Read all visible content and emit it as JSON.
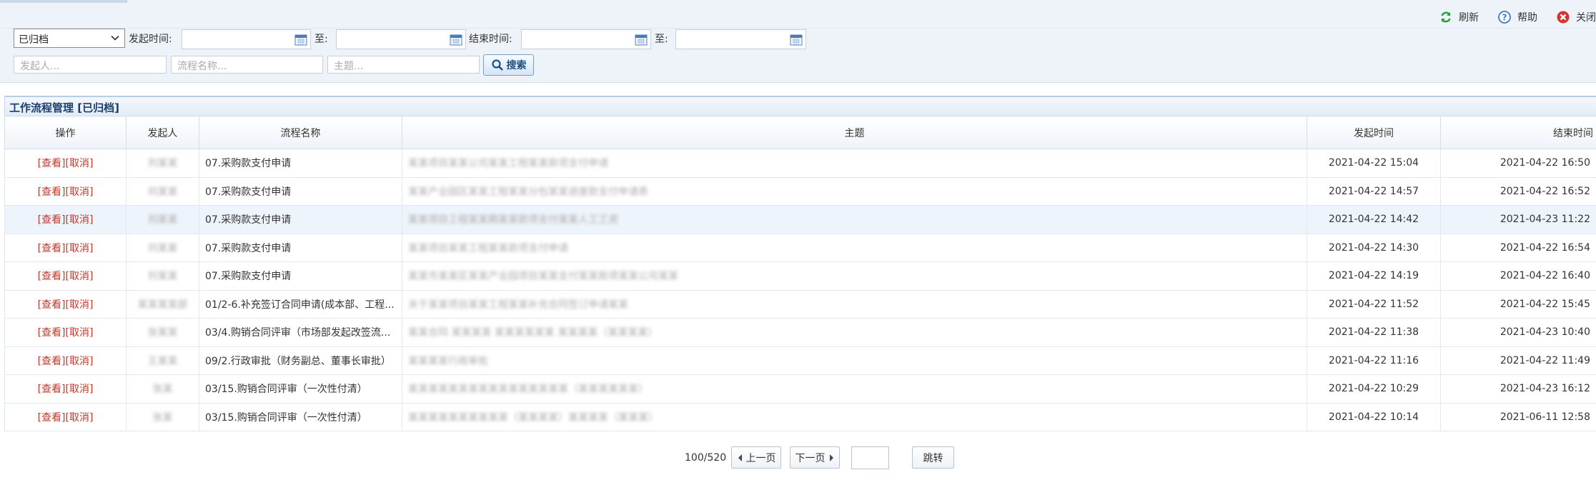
{
  "toolbar": {
    "refresh_label": "刷新",
    "help_label": "帮助",
    "close_label": "关闭"
  },
  "filter": {
    "status_value": "已归档",
    "start_label": "发起时间:",
    "to_label": "至:",
    "end_label": "结束时间:",
    "to_label2": "至:",
    "initiator_placeholder": "发起人...",
    "flow_placeholder": "流程名称...",
    "subject_placeholder": "主题...",
    "search_label": "搜索"
  },
  "panel": {
    "title": "工作流程管理 [已归档]"
  },
  "table": {
    "headers": [
      "操作",
      "发起人",
      "流程名称",
      "主题",
      "发起时间",
      "结束时间"
    ],
    "rows": [
      {
        "view": "[查看]",
        "cancel": "[取消]",
        "initiator": "刘某某",
        "flow": "07.采购款支付申请",
        "subject": "某某项目某某公司某某工程某某款项支付申请",
        "start": "2021-04-22 15:04",
        "end": "2021-04-22 16:50"
      },
      {
        "view": "[查看]",
        "cancel": "[取消]",
        "initiator": "刘某某",
        "flow": "07.采购款支付申请",
        "subject": "某某产业园区某某工程某某分包某某进度款支付申请表",
        "start": "2021-04-22 14:57",
        "end": "2021-04-22 16:52"
      },
      {
        "view": "[查看]",
        "cancel": "[取消]",
        "initiator": "刘某某",
        "flow": "07.采购款支付申请",
        "subject": "某某项目工程某某期某某款项支付某某人工工资",
        "start": "2021-04-22 14:42",
        "end": "2021-04-23 11:22"
      },
      {
        "view": "[查看]",
        "cancel": "[取消]",
        "initiator": "刘某某",
        "flow": "07.采购款支付申请",
        "subject": "某某项目某某工程某某款项支付申请",
        "start": "2021-04-22 14:30",
        "end": "2021-04-22 16:54"
      },
      {
        "view": "[查看]",
        "cancel": "[取消]",
        "initiator": "刘某某",
        "flow": "07.采购款支付申请",
        "subject": "某某市某某区某某产业园项目某某支付某某款项某某公司某某",
        "start": "2021-04-22 14:19",
        "end": "2021-04-22 16:40"
      },
      {
        "view": "[查看]",
        "cancel": "[取消]",
        "initiator": "某某某某部",
        "flow": "01/2-6.补充签订合同申请(成本部、工程...",
        "subject": "关于某某项目某某工程某某补充合同签订申请某某",
        "start": "2021-04-22 11:52",
        "end": "2021-04-22 15:45"
      },
      {
        "view": "[查看]",
        "cancel": "[取消]",
        "initiator": "张某某",
        "flow": "03/4.购销合同评审（市场部发起改签流...",
        "subject": "某某合同 某某某某 某某某某某某 某某某某（某某某某）",
        "start": "2021-04-22 11:38",
        "end": "2021-04-23 10:40"
      },
      {
        "view": "[查看]",
        "cancel": "[取消]",
        "initiator": "王某某",
        "flow": "09/2.行政审批（财务副总、董事长审批）",
        "subject": "某某某某行政审批",
        "start": "2021-04-22 11:16",
        "end": "2021-04-22 11:49"
      },
      {
        "view": "[查看]",
        "cancel": "[取消]",
        "initiator": "张某",
        "flow": "03/15.购销合同评审（一次性付清）",
        "subject": "某某某某某某某某某某某某某某某某（某某某某某某）",
        "start": "2021-04-22 10:29",
        "end": "2021-04-23 16:12"
      },
      {
        "view": "[查看]",
        "cancel": "[取消]",
        "initiator": "张某",
        "flow": "03/15.购销合同评审（一次性付清）",
        "subject": "某某某某某某某某某某（某某某某）某某某某（某某某）",
        "start": "2021-04-22 10:14",
        "end": "2021-06-11 12:58"
      }
    ]
  },
  "pager": {
    "count": "100/520",
    "prev_label": "上一页",
    "next_label": "下一页",
    "jump_label": "跳转"
  }
}
